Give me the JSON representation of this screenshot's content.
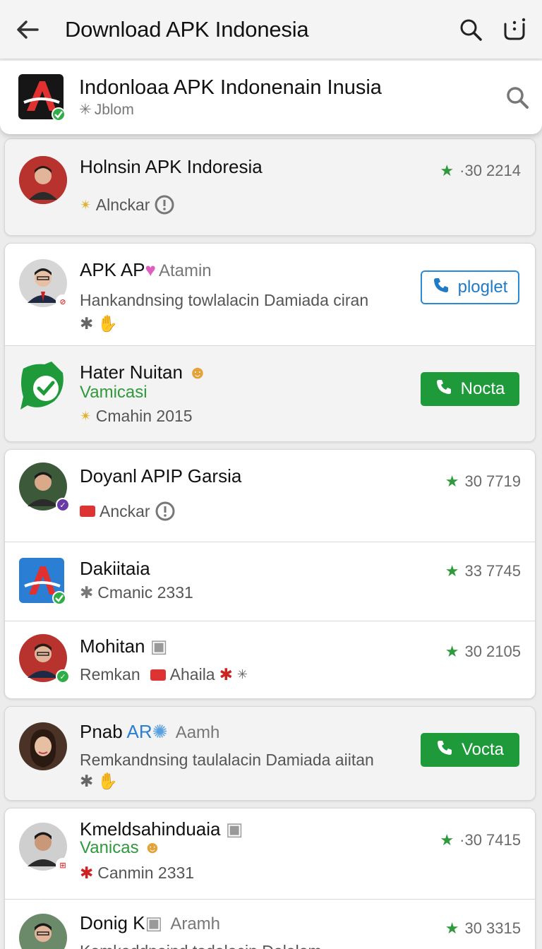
{
  "appbar": {
    "title": "Download APK Indonesia"
  },
  "header": {
    "title": "Indonloaa APK Indonenain Inusia",
    "subtitle": "✳ Jblom"
  },
  "items": [
    {
      "title": "Holnsin APK Indoresia",
      "sub": "Alnckar",
      "rating": "·30 2214"
    },
    {
      "title": "APK AP",
      "title_extra": "Atamin",
      "desc": "Hankandnsing towlalacin Damiada ciran",
      "button": "ploglet"
    },
    {
      "title": "Hater Nuitan",
      "green": "Vamicasi",
      "sub": "Cmahin 2015",
      "button": "Nocta"
    },
    {
      "title": "Doyanl APIP Garsia",
      "sub": "Anckar",
      "rating": "30 7719"
    },
    {
      "title": "Dakiitaia",
      "sub": "Cmanic 2331",
      "rating": "33 7745"
    },
    {
      "title": "Mohitan",
      "sub": "Remkan",
      "sub2": "Ahaila",
      "rating": "30 2105"
    },
    {
      "title": "Pnab",
      "title_blue": "AR",
      "title_extra": "Aamh",
      "desc": "Remkandnsing taulalacin Damiada aiitan",
      "button": "Vocta"
    },
    {
      "title": "Kmeldsahinduaia",
      "green": "Vanicas",
      "sub": "Canmin 2331",
      "rating": "·30 7415"
    },
    {
      "title": "Donig K",
      "title_extra": "Aramh",
      "desc": "Kemkaddnaind tadalacin Dalalem",
      "rating": "30 3315"
    }
  ],
  "colors": {
    "accent_green": "#1e9a3a",
    "accent_blue": "#2a7fd4"
  }
}
